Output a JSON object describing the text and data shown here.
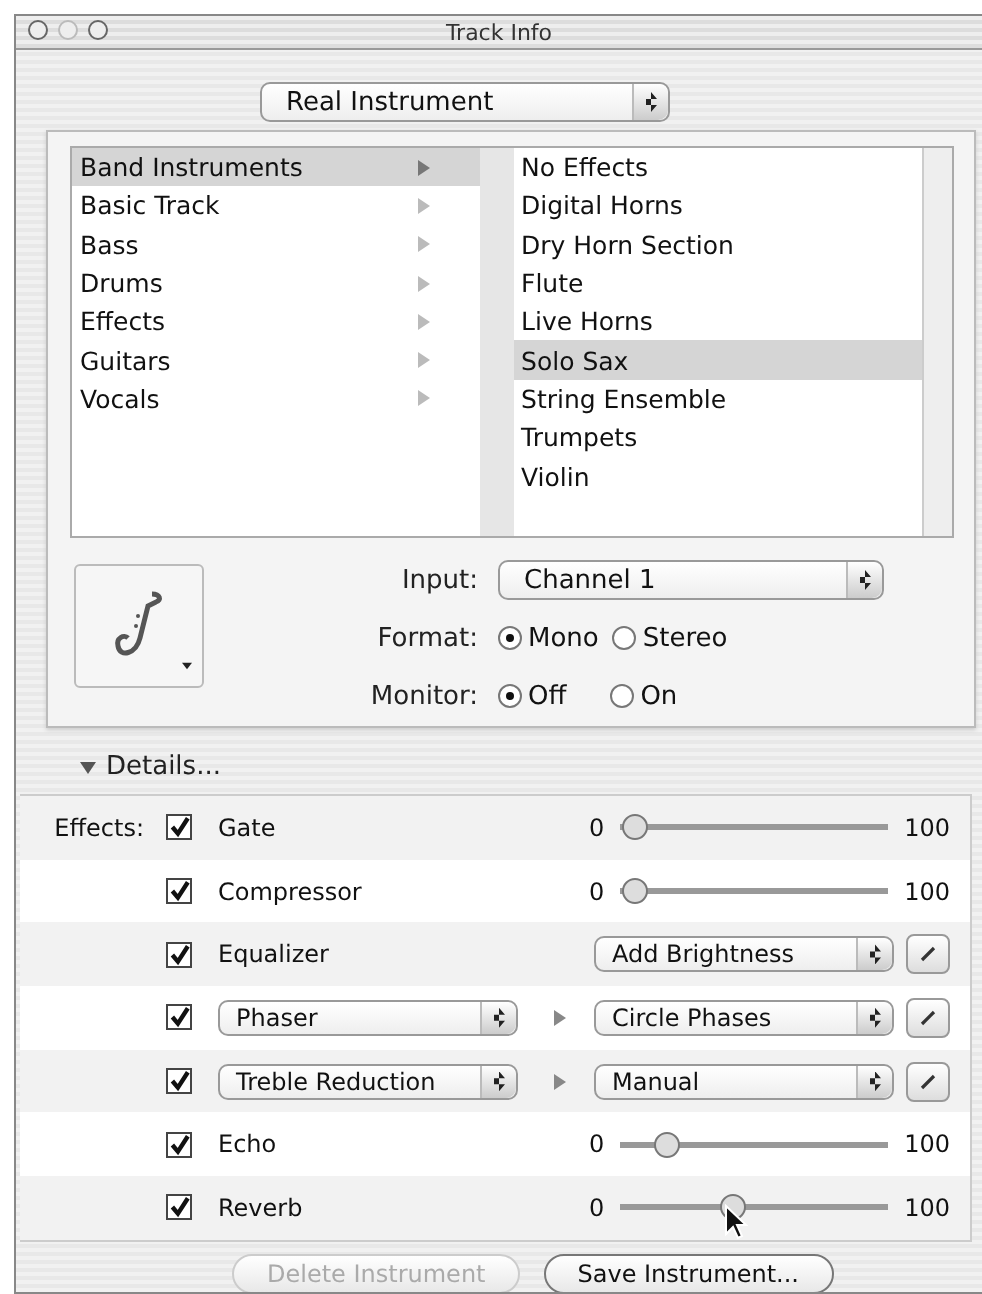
{
  "window": {
    "title": "Track Info"
  },
  "track_type": {
    "value": "Real Instrument"
  },
  "categories": [
    {
      "label": "Band Instruments",
      "selected": true
    },
    {
      "label": "Basic Track",
      "selected": false
    },
    {
      "label": "Bass",
      "selected": false
    },
    {
      "label": "Drums",
      "selected": false
    },
    {
      "label": "Effects",
      "selected": false
    },
    {
      "label": "Guitars",
      "selected": false
    },
    {
      "label": "Vocals",
      "selected": false
    }
  ],
  "instruments": [
    {
      "label": "No Effects",
      "selected": false
    },
    {
      "label": "Digital Horns",
      "selected": false
    },
    {
      "label": "Dry Horn Section",
      "selected": false
    },
    {
      "label": "Flute",
      "selected": false
    },
    {
      "label": "Live Horns",
      "selected": false
    },
    {
      "label": "Solo Sax",
      "selected": true
    },
    {
      "label": "String Ensemble",
      "selected": false
    },
    {
      "label": "Trumpets",
      "selected": false
    },
    {
      "label": "Violin",
      "selected": false
    }
  ],
  "input": {
    "label": "Input:",
    "value": "Channel 1"
  },
  "format": {
    "label": "Format:",
    "options": [
      {
        "label": "Mono",
        "selected": true
      },
      {
        "label": "Stereo",
        "selected": false
      }
    ]
  },
  "monitor": {
    "label": "Monitor:",
    "options": [
      {
        "label": "Off",
        "selected": true
      },
      {
        "label": "On",
        "selected": false
      }
    ]
  },
  "details": {
    "label": "Details...",
    "expanded": true
  },
  "effects": {
    "label": "Effects:",
    "rows": [
      {
        "kind": "slider",
        "name": "Gate",
        "checked": true,
        "min": "0",
        "max": "100",
        "level": 0.05
      },
      {
        "kind": "slider",
        "name": "Compressor",
        "checked": true,
        "min": "0",
        "max": "100",
        "level": 0.05
      },
      {
        "kind": "preset",
        "name": "Equalizer",
        "checked": true,
        "preset": "Add Brightness"
      },
      {
        "kind": "chain",
        "name": "Phaser",
        "checked": true,
        "preset": "Circle Phases"
      },
      {
        "kind": "chain",
        "name": "Treble Reduction",
        "checked": true,
        "preset": "Manual"
      },
      {
        "kind": "slider",
        "name": "Echo",
        "checked": true,
        "min": "0",
        "max": "100",
        "level": 0.17
      },
      {
        "kind": "slider",
        "name": "Reverb",
        "checked": true,
        "min": "0",
        "max": "100",
        "level": 0.42
      }
    ]
  },
  "buttons": [
    {
      "label": "Delete Instrument",
      "disabled": true
    },
    {
      "label": "Save Instrument...",
      "disabled": false
    }
  ]
}
